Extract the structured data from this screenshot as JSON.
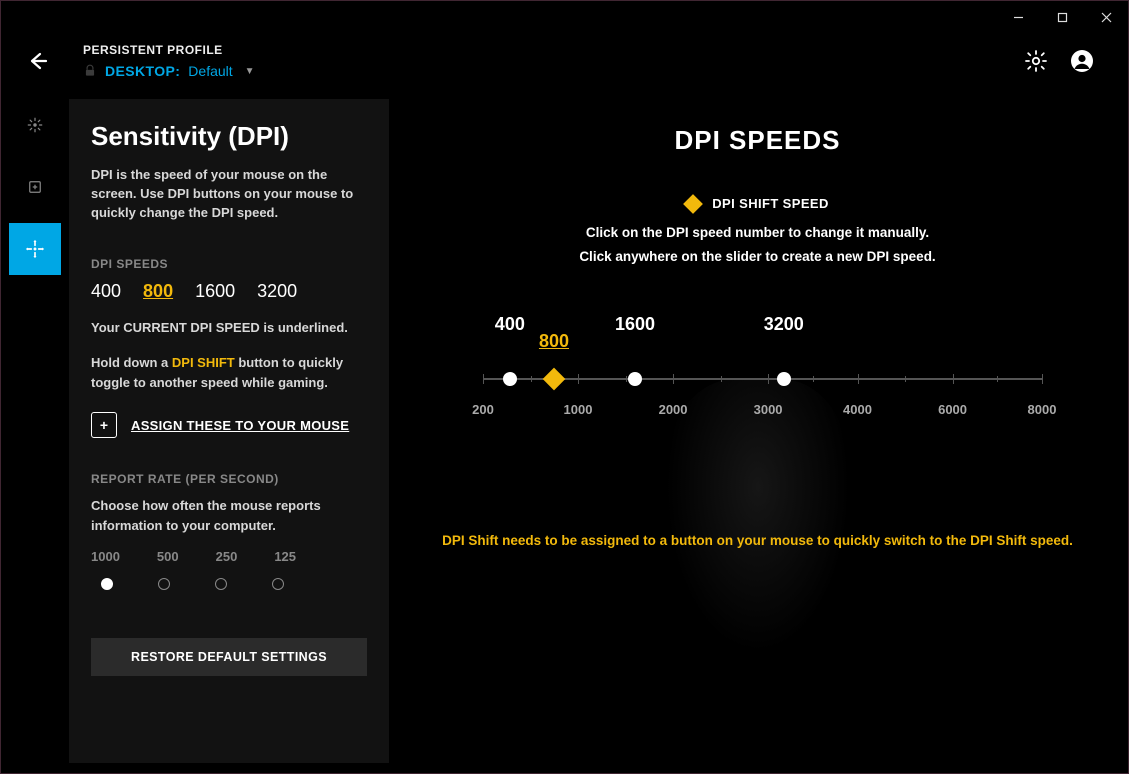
{
  "header": {
    "persistent_label": "PERSISTENT PROFILE",
    "desktop_label": "DESKTOP:",
    "profile_name": "Default"
  },
  "left": {
    "title": "Sensitivity (DPI)",
    "description": "DPI is the speed of your mouse on the screen. Use DPI buttons on your mouse to quickly change the DPI speed.",
    "dpi_speeds_label": "DPI SPEEDS",
    "dpi_values": [
      "400",
      "800",
      "1600",
      "3200"
    ],
    "active_dpi_index": 1,
    "current_info": "Your CURRENT DPI SPEED is underlined.",
    "shift_info_pre": "Hold down a ",
    "shift_info_accent": "DPI SHIFT",
    "shift_info_post": " button to quickly toggle to another speed while gaming.",
    "assign_label": "ASSIGN THESE TO YOUR MOUSE",
    "report_rate_label": "REPORT RATE (PER SECOND)",
    "report_rate_desc": "Choose how often the mouse reports information to your computer.",
    "report_rates": [
      "1000",
      "500",
      "250",
      "125"
    ],
    "selected_rate_index": 0,
    "restore_label": "RESTORE DEFAULT SETTINGS"
  },
  "main": {
    "title": "DPI SPEEDS",
    "shift_label": "DPI SHIFT SPEED",
    "hint1": "Click on the DPI speed number to change it manually.",
    "hint2": "Click anywhere on the slider to create a new DPI speed.",
    "tick_labels": [
      "200",
      "1000",
      "2000",
      "3000",
      "4000",
      "6000",
      "8000"
    ],
    "markers": [
      {
        "value": "400",
        "type": "white",
        "pos_pct": 4.8
      },
      {
        "value": "800",
        "type": "shift",
        "pos_pct": 12.7
      },
      {
        "value": "1600",
        "type": "white",
        "pos_pct": 27.2
      },
      {
        "value": "3200",
        "type": "white",
        "pos_pct": 53.8
      }
    ],
    "warning": "DPI Shift needs to be assigned to a button on your mouse to quickly switch to the DPI Shift speed."
  }
}
